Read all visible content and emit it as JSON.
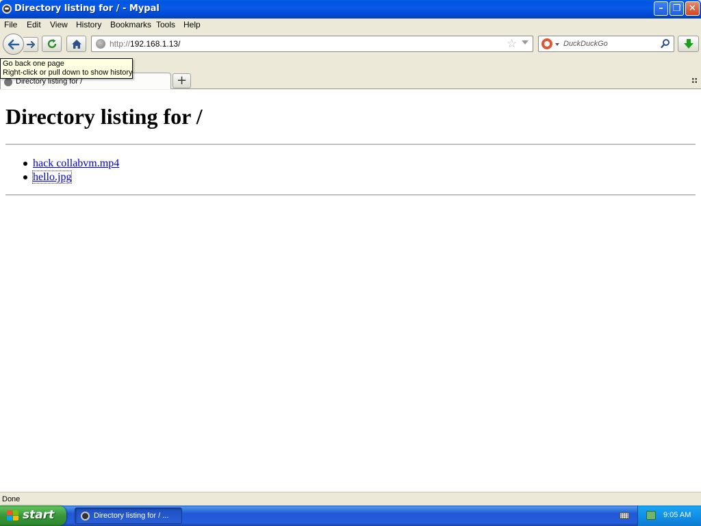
{
  "window": {
    "title": "Directory listing for / - Mypal",
    "minimize_glyph": "–",
    "maximize_glyph": "❐",
    "close_glyph": "✕"
  },
  "menubar": {
    "items": [
      {
        "label": "File"
      },
      {
        "label": "Edit"
      },
      {
        "label": "View"
      },
      {
        "label": "History"
      },
      {
        "label": "Bookmarks"
      },
      {
        "label": "Tools"
      },
      {
        "label": "Help"
      }
    ]
  },
  "navbar": {
    "url_scheme": "http://",
    "url_host": "192.168.1.13/",
    "search_placeholder": "DuckDuckGo"
  },
  "tooltip": {
    "line1": "Go back one page",
    "line2": "Right-click or pull down to show history"
  },
  "tabs": [
    {
      "label": "Directory listing for /",
      "active": true
    }
  ],
  "new_tab_glyph": "+",
  "page": {
    "heading": "Directory listing for /",
    "files": [
      {
        "name": "hack collabvm.mp4"
      },
      {
        "name": "hello.jpg"
      }
    ]
  },
  "status": {
    "text": "Done"
  },
  "taskbar": {
    "start_label": "start",
    "task_label": "Directory listing for / ...",
    "clock": "9:05 AM"
  },
  "colors": {
    "titlebar": "#0054e3",
    "link": "#0000cc",
    "tooltip_bg": "#ffffe1",
    "start_button": "#379637"
  }
}
